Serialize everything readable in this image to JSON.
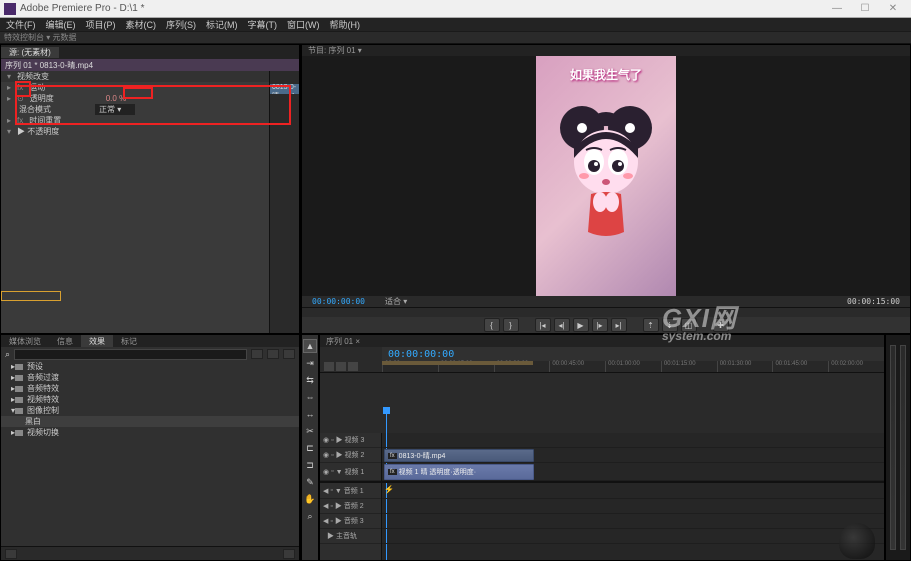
{
  "app": {
    "title": "Adobe Premiere Pro - D:\\1 *"
  },
  "menu": [
    "文件(F)",
    "编辑(E)",
    "项目(P)",
    "素材(C)",
    "序列(S)",
    "标记(M)",
    "字幕(T)",
    "窗口(W)",
    "帮助(H)"
  ],
  "subbar": "特效控制台 ▾   元数据",
  "effectControls": {
    "tabActive": "源: (无素材)",
    "clipName": "序列 01 * 0813-0-晴.mp4",
    "miniClip": "0813-0-晴.mp4",
    "group": "视频改变",
    "props": [
      {
        "name": "运动",
        "val": ""
      },
      {
        "name": "透明度",
        "val": "0.0 %"
      },
      {
        "name": "混合模式",
        "val": "正常 ▾"
      },
      {
        "name": "时间重置",
        "val": ""
      }
    ],
    "footer": "▶ 不透明度"
  },
  "program": {
    "tab": "节目: 序列 01 ▾",
    "caption": "如果我生气了",
    "tcLeft": "00:00:00:00",
    "tcRight": "00:00:15:00",
    "zoom": "适合 ▾"
  },
  "watermark": {
    "brand": "GXI网",
    "sub": "system.com"
  },
  "project": {
    "tabs": [
      "媒体浏览",
      "信息",
      "效果",
      "标记"
    ],
    "active": 2,
    "search": "",
    "items": [
      {
        "label": "预设",
        "child": false
      },
      {
        "label": "音频过渡",
        "child": false
      },
      {
        "label": "音频特效",
        "child": false
      },
      {
        "label": "视频特效",
        "child": false
      },
      {
        "label": "图像控制",
        "child": false,
        "open": true
      },
      {
        "label": "黑白",
        "child": true
      },
      {
        "label": "视频切换",
        "child": false
      }
    ]
  },
  "timeline": {
    "tab": "序列 01 ×",
    "tc": "00:00:00:00",
    "ticks": [
      "00:00",
      "00:00:15:00",
      "00:00:30:00",
      "00:00:45:00",
      "00:01:00:00",
      "00:01:15:00",
      "00:01:30:00",
      "00:01:45:00",
      "00:02:00:00"
    ],
    "vtracks": [
      {
        "name": "▶ 视频 3"
      },
      {
        "name": "▶ 视频 2",
        "clip": "0813-0-晴.mp4"
      },
      {
        "name": "▼ 视频 1",
        "clip": "视频 1 晴 透明度·透明度·"
      }
    ],
    "atracks": [
      {
        "name": "▼ 音频 1"
      },
      {
        "name": "▶ 音频 2"
      },
      {
        "name": "▶ 音频 3"
      },
      {
        "name": "▶ 主音轨"
      }
    ]
  }
}
